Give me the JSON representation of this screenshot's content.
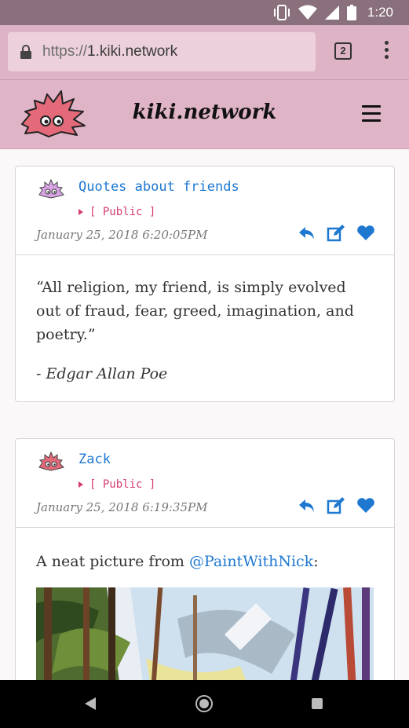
{
  "status_bar": {
    "time": "1:20",
    "icons": [
      "vibrate-icon",
      "wifi-icon",
      "signal-icon",
      "battery-icon"
    ]
  },
  "browser": {
    "url_scheme": "https://",
    "url_host": "1.kiki.network",
    "tab_count": "2"
  },
  "site": {
    "title": "kiki.network",
    "accent": "#e0b4c7"
  },
  "posts": [
    {
      "author": "Quotes about friends",
      "visibility": "[ Public ]",
      "timestamp": "January 25, 2018 6:20:05PM",
      "quote": "“All religion, my friend, is simply evolved out of fraud, fear, greed, imagination, and poetry.”",
      "attribution_prefix": "- ",
      "attribution": "Edgar Allan Poe"
    },
    {
      "author": "Zack",
      "visibility": "[ Public ]",
      "timestamp": "January 25, 2018 6:19:35PM",
      "text_prefix": "A neat picture from ",
      "mention": "@PaintWithNick",
      "text_suffix": ":"
    }
  ],
  "colors": {
    "link": "#1e78d0",
    "visibility": "#d63d6e",
    "icon": "#1e78d0"
  }
}
